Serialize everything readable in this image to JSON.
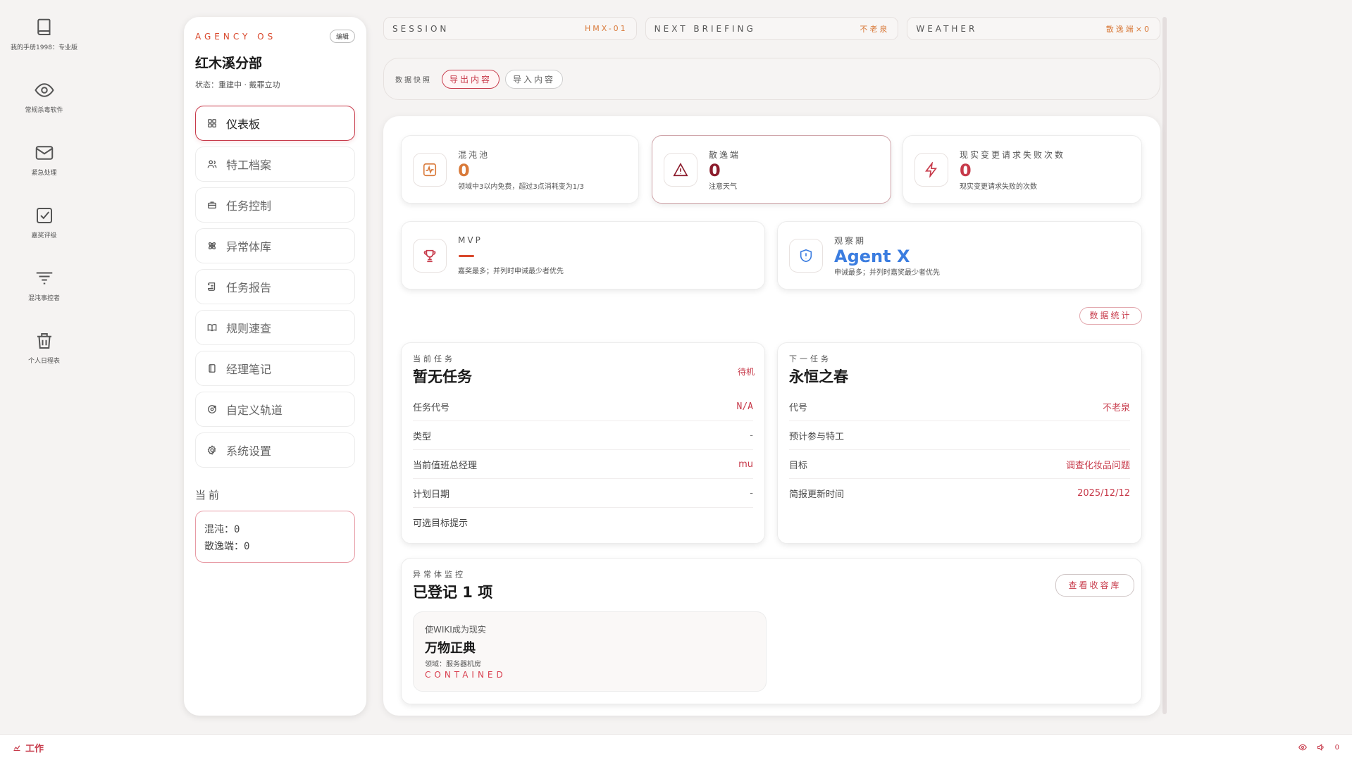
{
  "desktop": {
    "icons": [
      {
        "label": "我的手册1998：专业版",
        "icon": "book-icon"
      },
      {
        "label": "常规杀毒软件",
        "icon": "eye-icon"
      },
      {
        "label": "紧急处理",
        "icon": "mail-icon"
      },
      {
        "label": "嘉奖评级",
        "icon": "checkbox-icon"
      },
      {
        "label": "混沌事控者",
        "icon": "filter-icon"
      },
      {
        "label": "个人日程表",
        "icon": "trash-icon"
      }
    ]
  },
  "sidebar": {
    "brand": "AGENCY OS",
    "edit_label": "编辑",
    "title": "红木溪分部",
    "status": "状态：重建中 · 戴罪立功",
    "nav": [
      {
        "label": "仪表板",
        "icon": "grid-icon",
        "active": true
      },
      {
        "label": "特工档案",
        "icon": "users-icon"
      },
      {
        "label": "任务控制",
        "icon": "briefcase-icon"
      },
      {
        "label": "异常体库",
        "icon": "atom-icon"
      },
      {
        "label": "任务报告",
        "icon": "scroll-icon"
      },
      {
        "label": "规则速查",
        "icon": "book-open-icon"
      },
      {
        "label": "经理笔记",
        "icon": "notebook-icon"
      },
      {
        "label": "自定义轨道",
        "icon": "orbit-icon"
      },
      {
        "label": "系统设置",
        "icon": "gear-icon"
      }
    ],
    "current_title": "当前",
    "current_chaos": "混沌：0",
    "current_loose": "散逸端：0"
  },
  "top": {
    "session_label": "SESSION",
    "session_value": "HMX-01",
    "briefing_label": "NEXT BRIEFING",
    "briefing_value": "不老泉",
    "weather_label": "WEATHER",
    "weather_value": "散逸端×0"
  },
  "snapshot": {
    "label": "数据快照",
    "export_label": "导出内容",
    "import_label": "导入内容"
  },
  "stats": {
    "chaos": {
      "label": "混沌池",
      "value": "0",
      "sub": "领域中3以内免费，超过3点消耗变为1/3"
    },
    "loose": {
      "label": "散逸端",
      "value": "0",
      "sub": "注意天气"
    },
    "reality": {
      "label": "现实变更请求失败次数",
      "value": "0",
      "sub": "现实变更请求失败的次数"
    },
    "mvp": {
      "label": "MVP",
      "value": "—",
      "sub": "嘉奖最多；并列时申诫最少者优先"
    },
    "watch": {
      "label": "观察期",
      "value": "Agent X",
      "sub": "申诫最多；并列时嘉奖最少者优先"
    }
  },
  "stats_button": "数据统计",
  "current_mission": {
    "kicker": "当前任务",
    "title": "暂无任务",
    "badge": "待机",
    "rows": [
      {
        "k": "任务代号",
        "v": "N/A"
      },
      {
        "k": "类型",
        "v": "-"
      },
      {
        "k": "当前值班总经理",
        "v": "mu"
      },
      {
        "k": "计划日期",
        "v": "-"
      },
      {
        "k": "可选目标提示",
        "v": ""
      }
    ]
  },
  "next_mission": {
    "kicker": "下一任务",
    "title": "永恒之春",
    "rows": [
      {
        "k": "代号",
        "v": "不老泉"
      },
      {
        "k": "预计参与特工",
        "v": ""
      },
      {
        "k": "目标",
        "v": "调查化妆品问题"
      },
      {
        "k": "简报更新时间",
        "v": "2025/12/12"
      }
    ]
  },
  "anomaly": {
    "kicker": "异常体监控",
    "title": "已登记 1 项",
    "button": "查看收容库",
    "item": {
      "sub": "使WIKI成为现实",
      "title": "万物正典",
      "meta": "领域：服务器机房",
      "status": "CONTAINED"
    }
  },
  "taskbar": {
    "work_label": "工作",
    "counter": "0"
  },
  "colors": {
    "accent": "#c73a4a",
    "orange": "#d97a3a",
    "dark_red": "#8c1c2c",
    "blue": "#3b7de0"
  }
}
